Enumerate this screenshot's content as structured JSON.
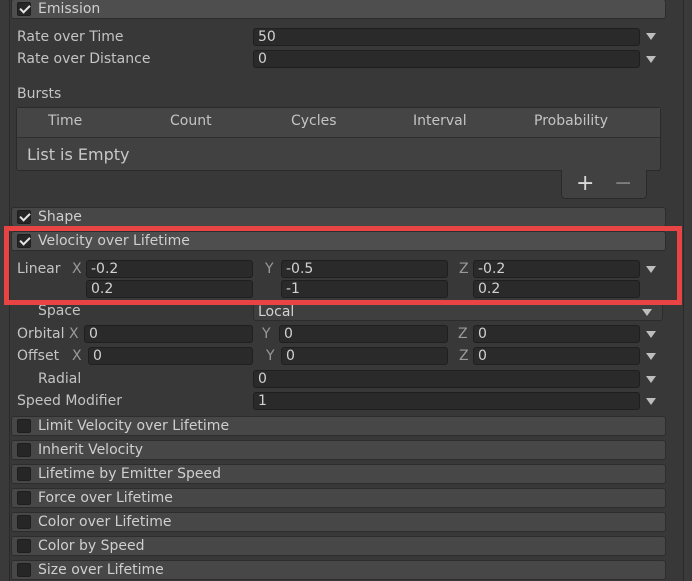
{
  "emission": {
    "title": "Emission",
    "checked": true,
    "rate_over_time_label": "Rate over Time",
    "rate_over_time_value": "50",
    "rate_over_distance_label": "Rate over Distance",
    "rate_over_distance_value": "0",
    "bursts_label": "Bursts",
    "bursts_columns": [
      "Time",
      "Count",
      "Cycles",
      "Interval",
      "Probability"
    ],
    "bursts_empty_text": "List is Empty",
    "add_symbol": "+",
    "remove_symbol": "−"
  },
  "shape": {
    "title": "Shape",
    "checked": true
  },
  "velocity": {
    "title": "Velocity over Lifetime",
    "checked": true,
    "linear_label": "Linear",
    "axis_x": "X",
    "axis_y": "Y",
    "axis_z": "Z",
    "linear_x_min": "-0.2",
    "linear_x_max": "0.2",
    "linear_y_min": "-0.5",
    "linear_y_max": "-1",
    "linear_z_min": "-0.2",
    "linear_z_max": "0.2",
    "space_label": "Space",
    "space_value": "Local",
    "orbital_label": "Orbital",
    "orbital_x": "0",
    "orbital_y": "0",
    "orbital_z": "0",
    "offset_label": "Offset",
    "offset_x": "0",
    "offset_y": "0",
    "offset_z": "0",
    "radial_label": "Radial",
    "radial_value": "0",
    "speed_modifier_label": "Speed Modifier",
    "speed_modifier_value": "1"
  },
  "modules": [
    {
      "title": "Limit Velocity over Lifetime",
      "checked": false
    },
    {
      "title": "Inherit Velocity",
      "checked": false
    },
    {
      "title": "Lifetime by Emitter Speed",
      "checked": false
    },
    {
      "title": "Force over Lifetime",
      "checked": false
    },
    {
      "title": "Color over Lifetime",
      "checked": false
    },
    {
      "title": "Color by Speed",
      "checked": false
    },
    {
      "title": "Size over Lifetime",
      "checked": false
    }
  ],
  "colors": {
    "highlight": "#e84443",
    "panel_bg": "#383838",
    "field_bg": "#2a2a2a",
    "header_bg": "#474747"
  }
}
